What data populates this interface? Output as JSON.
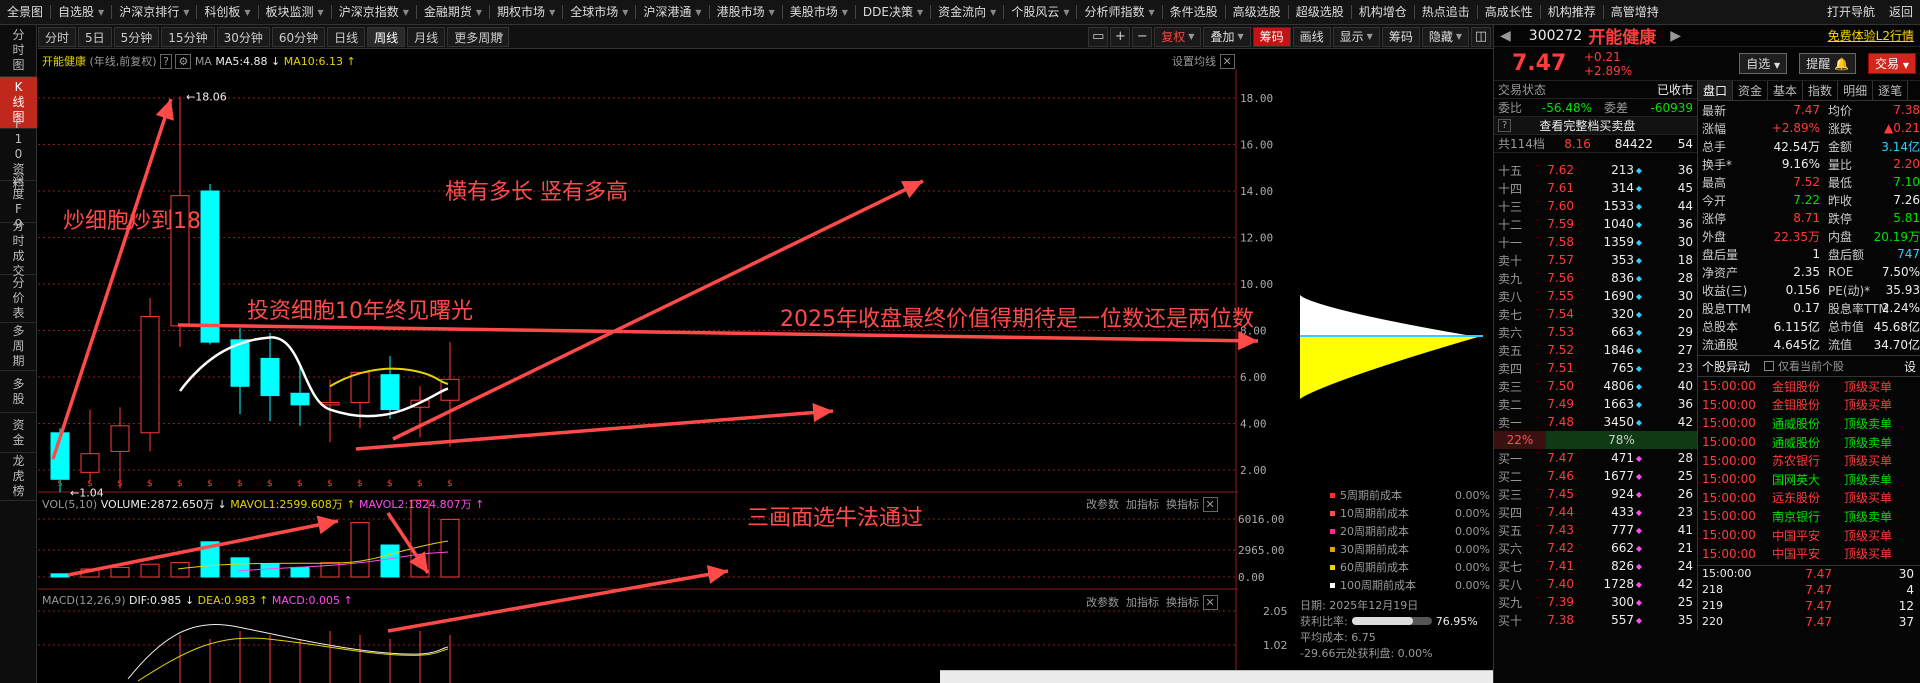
{
  "top_nav": [
    "全景图",
    "自选股",
    "沪深京排行",
    "科创板",
    "板块监测",
    "沪深京指数",
    "金融期货",
    "期权市场",
    "全球市场",
    "沪深港通",
    "港股市场",
    "美股市场",
    "DDE决策",
    "资金流向",
    "个股风云",
    "分析师指数",
    "条件选股",
    "高级选股",
    "超级选股",
    "机构增仓",
    "热点追击",
    "高成长性",
    "机构推荐",
    "高管增持",
    "打开导航",
    "返回"
  ],
  "left_bar": [
    "分时图",
    "K线图",
    "F10资料",
    "深度F9",
    "分时成交",
    "分价表",
    "多周期",
    "多股",
    "资金",
    "龙虎榜"
  ],
  "period_tabs": [
    "分时",
    "5日",
    "5分钟",
    "15分钟",
    "30分钟",
    "60分钟",
    "日线",
    "周线",
    "月线",
    "更多周期"
  ],
  "toolbar_right": {
    "fuquan": "复权",
    "diejia": "叠加",
    "choumа": "筹码",
    "huaxian": "画线",
    "xianshi": "显示",
    "chouma2": "筹码",
    "yincang": "隐藏"
  },
  "chart": {
    "stock_name": "开能健康",
    "mode": "(年线,前复权)",
    "ma_label": "MA",
    "ma5": "MA5:4.88",
    "ma10": "MA10:6.13",
    "settings": "设置均线",
    "high_mark": "18.06",
    "low_mark": "1.04",
    "y_ticks": [
      "18.00",
      "16.00",
      "14.00",
      "12.00",
      "10.00",
      "8.00",
      "6.00",
      "4.00",
      "2.00"
    ],
    "vol_label": "VOL(5,10)",
    "volume": "VOLUME:2872.650万",
    "mavol1": "MAVOL1:2599.608万",
    "mavol2": "MAVOL2:1824.807万",
    "vol_ticks": [
      "6016.00",
      "2965.00",
      "0.00"
    ],
    "macd_label": "MACD(12,26,9)",
    "dif": "DIF:0.985",
    "dea": "DEA:0.983",
    "macd": "MACD:0.005",
    "macd_ticks": [
      "2.05",
      "1.02"
    ],
    "panel_btns": [
      "改参数",
      "加指标",
      "换指标"
    ],
    "dollar_marks": "$"
  },
  "cost_dist": {
    "rows": [
      {
        "label": "5周期前成本",
        "value": "0.00%",
        "color": "#ff3030"
      },
      {
        "label": "10周期前成本",
        "value": "0.00%",
        "color": "#ff5050"
      },
      {
        "label": "20周期前成本",
        "value": "0.00%",
        "color": "#ff2a8a"
      },
      {
        "label": "30周期前成本",
        "value": "0.00%",
        "color": "#e6a000"
      },
      {
        "label": "60周期前成本",
        "value": "0.00%",
        "color": "#e6d400"
      },
      {
        "label": "100周期前成本",
        "value": "0.00%",
        "color": "#ffffff"
      }
    ],
    "date_label": "日期: 2025年12月19日",
    "profit_label": "获利比率:",
    "profit_value": "76.95%",
    "avg_cost": "平均成本: 6.75",
    "note": "-29.66元处获利盘: 0.00%"
  },
  "annotations": {
    "a1": "炒细胞炒到18",
    "a2": "横有多长 竖有多高",
    "a3": "投资细胞10年终见曙光",
    "a4": "2025年收盘最终价值得期待是一位数还是两位数",
    "a5": "三画面选牛法通过"
  },
  "quote": {
    "code": "300272",
    "name": "开能健康",
    "l2": "免费体验L2行情",
    "price": "7.47",
    "change": "+0.21",
    "pct": "+2.89%",
    "zixuan": "自选",
    "tixing": "提醒",
    "jiaoyi": "交易",
    "status_label": "交易状态",
    "status": "已收市",
    "tabs": [
      "盘口",
      "资金",
      "基本",
      "指数",
      "明细",
      "逐笔"
    ],
    "weibi_label": "委比",
    "weibi": "-56.48%",
    "weicha_label": "委差",
    "weicha": "-60939",
    "full_book": "查看完整档买卖盘",
    "total_levels": "共114档",
    "total_price": "8.16",
    "total_vol": "84422",
    "total_cnt": "54",
    "sells": [
      {
        "l": "十五",
        "p": "7.62",
        "v": "213",
        "c": "36"
      },
      {
        "l": "十四",
        "p": "7.61",
        "v": "314",
        "c": "45"
      },
      {
        "l": "十三",
        "p": "7.60",
        "v": "1533",
        "c": "44"
      },
      {
        "l": "十二",
        "p": "7.59",
        "v": "1040",
        "c": "36"
      },
      {
        "l": "十一",
        "p": "7.58",
        "v": "1359",
        "c": "30"
      },
      {
        "l": "卖十",
        "p": "7.57",
        "v": "353",
        "c": "18"
      },
      {
        "l": "卖九",
        "p": "7.56",
        "v": "836",
        "c": "28"
      },
      {
        "l": "卖八",
        "p": "7.55",
        "v": "1690",
        "c": "30"
      },
      {
        "l": "卖七",
        "p": "7.54",
        "v": "320",
        "c": "20"
      },
      {
        "l": "卖六",
        "p": "7.53",
        "v": "663",
        "c": "29"
      },
      {
        "l": "卖五",
        "p": "7.52",
        "v": "1846",
        "c": "27"
      },
      {
        "l": "卖四",
        "p": "7.51",
        "v": "765",
        "c": "23"
      },
      {
        "l": "卖三",
        "p": "7.50",
        "v": "4806",
        "c": "40"
      },
      {
        "l": "卖二",
        "p": "7.49",
        "v": "1663",
        "c": "36"
      },
      {
        "l": "卖一",
        "p": "7.48",
        "v": "3450",
        "c": "42"
      }
    ],
    "sell_ratio": "22%",
    "buy_ratio": "78%",
    "buys": [
      {
        "l": "买一",
        "p": "7.47",
        "v": "471",
        "c": "28"
      },
      {
        "l": "买二",
        "p": "7.46",
        "v": "1677",
        "c": "25"
      },
      {
        "l": "买三",
        "p": "7.45",
        "p2": "",
        "v": "924",
        "c": "26"
      },
      {
        "l": "买四",
        "p": "7.44",
        "v": "433",
        "c": "23"
      },
      {
        "l": "买五",
        "p": "7.43",
        "v": "777",
        "c": "41"
      },
      {
        "l": "买六",
        "p": "7.42",
        "v": "662",
        "c": "21"
      },
      {
        "l": "买七",
        "p": "7.41",
        "v": "826",
        "c": "24"
      },
      {
        "l": "买八",
        "p": "7.40",
        "v": "1728",
        "c": "42"
      },
      {
        "l": "买九",
        "p": "7.39",
        "v": "300",
        "c": "25"
      },
      {
        "l": "买十",
        "p": "7.38",
        "v": "557",
        "c": "35"
      }
    ],
    "stats": [
      {
        "k": "最新",
        "v": "7.47",
        "vc": "red",
        "k2": "均价",
        "v2": "7.38",
        "v2c": "red"
      },
      {
        "k": "涨幅",
        "v": "+2.89%",
        "vc": "red",
        "k2": "涨跌",
        "v2": "▲0.21",
        "v2c": "red"
      },
      {
        "k": "总手",
        "v": "42.54万",
        "vc": "white",
        "k2": "金额",
        "v2": "3.14亿",
        "v2c": "cyan"
      },
      {
        "k": "换手*",
        "v": "9.16%",
        "vc": "white",
        "k2": "量比",
        "v2": "2.20",
        "v2c": "red"
      },
      {
        "k": "最高",
        "v": "7.52",
        "vc": "red",
        "k2": "最低",
        "v2": "7.10",
        "v2c": "green"
      },
      {
        "k": "今开",
        "v": "7.22",
        "vc": "green",
        "k2": "昨收",
        "v2": "7.26",
        "v2c": "white"
      },
      {
        "k": "涨停",
        "v": "8.71",
        "vc": "red",
        "k2": "跌停",
        "v2": "5.81",
        "v2c": "green"
      },
      {
        "k": "外盘",
        "v": "22.35万",
        "vc": "red",
        "k2": "内盘",
        "v2": "20.19万",
        "v2c": "green"
      },
      {
        "k": "盘后量",
        "v": "1",
        "vc": "white",
        "k2": "盘后额",
        "v2": "747",
        "v2c": "cyan"
      },
      {
        "k": "净资产",
        "v": "2.35",
        "vc": "white",
        "k2": "ROE",
        "v2": "7.50%",
        "v2c": "white"
      },
      {
        "k": "收益(三)",
        "v": "0.156",
        "vc": "white",
        "k2": "PE(动)*",
        "v2": "35.93",
        "v2c": "white"
      },
      {
        "k": "股息TTM",
        "v": "0.17",
        "vc": "white",
        "k2": "股息率TTM",
        "v2": "2.24%",
        "v2c": "white"
      },
      {
        "k": "总股本",
        "v": "6.115亿",
        "vc": "white",
        "k2": "总市值",
        "v2": "45.68亿",
        "v2c": "white"
      },
      {
        "k": "流通股",
        "v": "4.645亿",
        "vc": "white",
        "k2": "流值",
        "v2": "34.70亿",
        "v2c": "white"
      }
    ],
    "alerts_title": "个股异动",
    "alerts_check": "仅看当前个股",
    "alerts_settings": "设",
    "alerts": [
      {
        "t": "15:00:00",
        "n": "金钼股份",
        "y": "顶级买单",
        "c": "red"
      },
      {
        "t": "15:00:00",
        "n": "金钼股份",
        "y": "顶级买单",
        "c": "red"
      },
      {
        "t": "15:00:00",
        "n": "通威股份",
        "y": "顶级卖单",
        "c": "green"
      },
      {
        "t": "15:00:00",
        "n": "通威股份",
        "y": "顶级卖单",
        "c": "green"
      },
      {
        "t": "15:00:00",
        "n": "苏农银行",
        "y": "顶级买单",
        "c": "red"
      },
      {
        "t": "15:00:00",
        "n": "国网英大",
        "y": "顶级卖单",
        "c": "green"
      },
      {
        "t": "15:00:00",
        "n": "远东股份",
        "y": "顶级买单",
        "c": "red"
      },
      {
        "t": "15:00:00",
        "n": "南京银行",
        "y": "顶级卖单",
        "c": "green"
      },
      {
        "t": "15:00:00",
        "n": "中国平安",
        "y": "顶级买单",
        "c": "red"
      },
      {
        "t": "15:00:00",
        "n": "中国平安",
        "y": "顶级买单",
        "c": "red"
      }
    ],
    "ticks": [
      {
        "t": "15:00:00",
        "p": "7.47",
        "v": "30"
      },
      {
        "t": "218",
        "p": "7.47",
        "v": "4"
      },
      {
        "t": "219",
        "p": "7.47",
        "v": "12"
      },
      {
        "t": "220",
        "p": "7.47",
        "v": "37"
      }
    ]
  }
}
